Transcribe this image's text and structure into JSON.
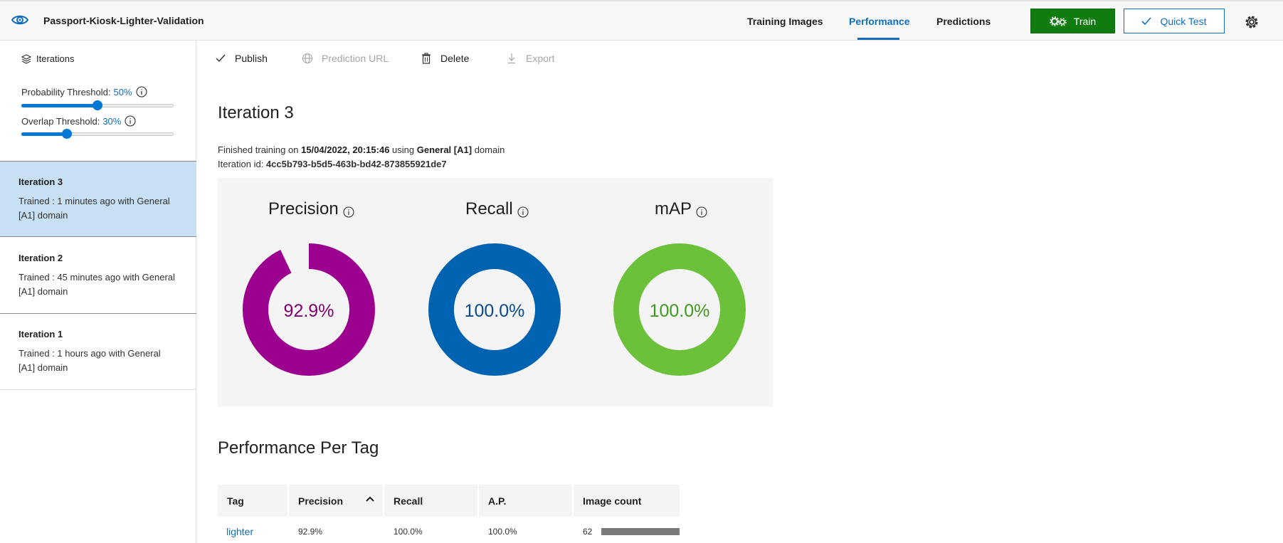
{
  "header": {
    "project_title": "Passport-Kiosk-Lighter-Validation",
    "tabs": [
      {
        "label": "Training Images",
        "active": false
      },
      {
        "label": "Performance",
        "active": true
      },
      {
        "label": "Predictions",
        "active": false
      }
    ],
    "train_label": "Train",
    "quick_test_label": "Quick Test",
    "colors": {
      "train": "#107c10",
      "accent": "#106ebe"
    }
  },
  "sidebar": {
    "iterations_label": "Iterations",
    "probability_threshold": {
      "label": "Probability Threshold:",
      "value_text": "50%",
      "value": 0.5
    },
    "overlap_threshold": {
      "label": "Overlap Threshold:",
      "value_text": "30%",
      "value": 0.3
    },
    "iterations": [
      {
        "name": "Iteration 3",
        "desc": "Trained : 1 minutes ago with General [A1] domain",
        "selected": true
      },
      {
        "name": "Iteration 2",
        "desc": "Trained : 45 minutes ago with General [A1] domain",
        "selected": false
      },
      {
        "name": "Iteration 1",
        "desc": "Trained : 1 hours ago with General [A1] domain",
        "selected": false
      }
    ]
  },
  "commands": {
    "publish": "Publish",
    "prediction_url": "Prediction URL",
    "delete": "Delete",
    "export": "Export"
  },
  "main": {
    "iteration_title": "Iteration 3",
    "trained_prefix": "Finished training on",
    "trained_date": "15/04/2022, 20:15:46",
    "trained_mid": "using",
    "trained_domain": "General [A1]",
    "trained_suffix": "domain",
    "iteration_id_label": "Iteration id:",
    "iteration_id": "4cc5b793-b5d5-463b-bd42-873855921de7",
    "metrics": [
      {
        "name": "Precision",
        "value_text": "92.9%",
        "value": 0.929,
        "color": "#9b008f",
        "text_color": "#7d0073"
      },
      {
        "name": "Recall",
        "value_text": "100.0%",
        "value": 1.0,
        "color": "#0063b1",
        "text_color": "#0a4a8f"
      },
      {
        "name": "mAP",
        "value_text": "100.0%",
        "value": 1.0,
        "color": "#6bc23a",
        "text_color": "#3f9a20"
      }
    ],
    "per_tag_title": "Performance Per Tag",
    "table": {
      "columns": [
        "Tag",
        "Precision",
        "Recall",
        "A.P.",
        "Image count"
      ],
      "rows": [
        {
          "tag": "lighter",
          "precision": "92.9%",
          "recall": "100.0%",
          "ap": "100.0%",
          "image_count": "62",
          "count_fraction": 1.0
        }
      ]
    }
  }
}
